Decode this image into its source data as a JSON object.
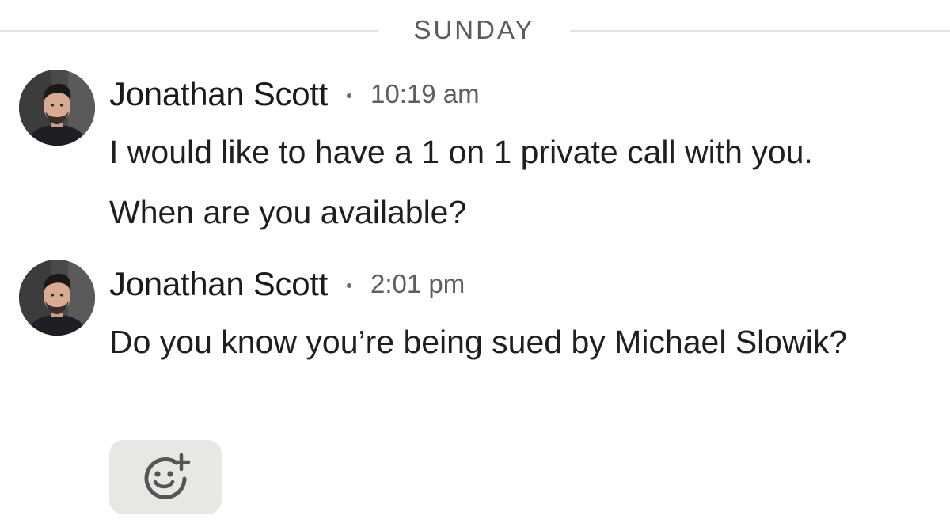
{
  "day_divider": {
    "label": "SUNDAY"
  },
  "messages": [
    {
      "sender": "Jonathan Scott",
      "time": "10:19 am",
      "text": "I would like to have a 1 on 1 private call with you. When are you available?",
      "avatar_icon": "profile-photo"
    },
    {
      "sender": "Jonathan Scott",
      "time": "2:01 pm",
      "text": "Do you know you’re being sued by Michael Slowik?",
      "avatar_icon": "profile-photo"
    }
  ],
  "reaction_button": {
    "icon": "add-emoji-icon"
  },
  "colors": {
    "divider_line": "#e3e3e3",
    "muted_text": "#5e5e5e",
    "reaction_bg": "#e9e7e4"
  }
}
